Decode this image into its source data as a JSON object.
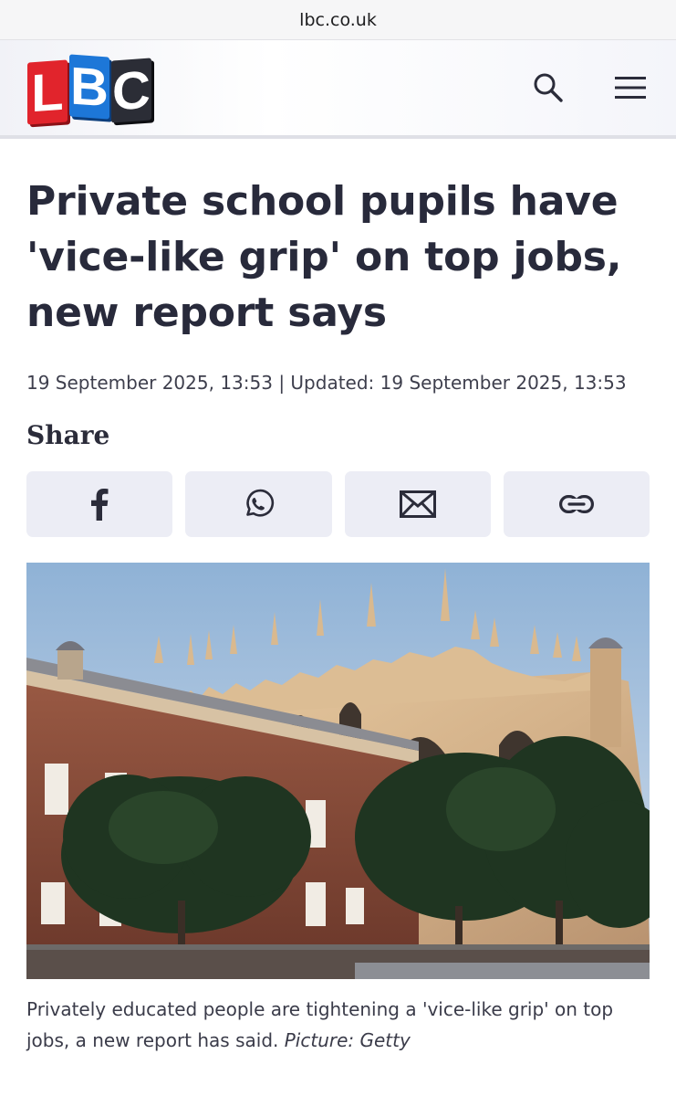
{
  "browser": {
    "url": "lbc.co.uk"
  },
  "header": {
    "logo_letters": [
      "L",
      "B",
      "C"
    ],
    "logo_colors": [
      "#e1242c",
      "#1d77d8",
      "#2b2d36"
    ],
    "search_icon": "search-icon",
    "menu_icon": "hamburger-menu-icon"
  },
  "article": {
    "headline": "Private school pupils have 'vice-like grip' on top jobs, new report says",
    "dateline": "19 September 2025, 13:53 | Updated: 19 September 2025, 13:53",
    "share_label": "Share",
    "share_buttons": [
      {
        "icon": "facebook-icon"
      },
      {
        "icon": "whatsapp-icon"
      },
      {
        "icon": "email-icon"
      },
      {
        "icon": "link-icon"
      }
    ],
    "caption": "Privately educated people are tightening a 'vice-like grip' on top jobs, a new report has said.",
    "caption_credit": "Picture: Getty"
  },
  "colors": {
    "text": "#2b2c3a",
    "share_bg": "#ecedf5",
    "sky": "#a9c3df",
    "stone": "#d6b58d",
    "brick": "#8a4a38",
    "tree": "#1f3521"
  }
}
